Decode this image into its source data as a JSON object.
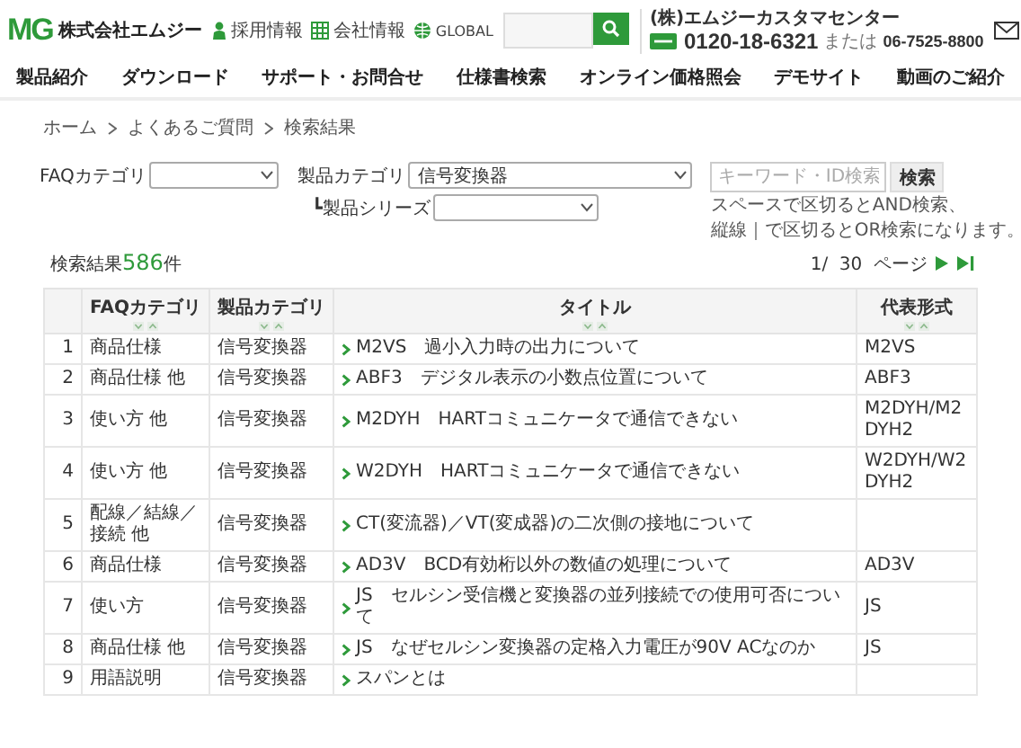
{
  "header": {
    "logo_mark": "MG",
    "company": "株式会社エムジー",
    "links": [
      {
        "kind": "person",
        "label": "採用情報"
      },
      {
        "kind": "building",
        "label": "会社情報"
      },
      {
        "kind": "globe",
        "label": "GLOBAL"
      }
    ],
    "support": {
      "label": "(株)エムジーカスタマセンター",
      "free_dial": "0120-18-6321",
      "or": "または",
      "phone": "06-7525-8800"
    }
  },
  "nav": [
    "製品紹介",
    "ダウンロード",
    "サポート・お問合せ",
    "仕様書検索",
    "オンライン価格照会",
    "デモサイト",
    "動画のご紹介"
  ],
  "breadcrumb": [
    "ホーム",
    "よくあるご質問",
    "検索結果"
  ],
  "filters": {
    "faq_category": {
      "label": "FAQカテゴリ"
    },
    "product_category": {
      "label": "製品カテゴリ",
      "value": "信号変換器"
    },
    "product_series": {
      "label": "┗製品シリーズ"
    },
    "keyword": {
      "placeholder": "キーワード・ID検索",
      "button": "検索",
      "help": [
        "スペースで区切るとAND検索、",
        "縦線｜で区切るとOR検索になります。"
      ]
    }
  },
  "results": {
    "prefix": "検索結果",
    "count": "586",
    "suffix": "件",
    "pager": "1/  30  ページ"
  },
  "table": {
    "columns": [
      "FAQカテゴリ",
      "製品カテゴリ",
      "タイトル",
      "代表形式"
    ],
    "rows": [
      {
        "no": "1",
        "faq": "商品仕様",
        "product": "信号変換器",
        "title": "M2VS　過小入力時の出力について",
        "model": "M2VS"
      },
      {
        "no": "2",
        "faq": "商品仕様 他",
        "product": "信号変換器",
        "title": "ABF3　デジタル表示の小数点位置について",
        "model": "ABF3"
      },
      {
        "no": "3",
        "faq": "使い方 他",
        "product": "信号変換器",
        "title": "M2DYH　HARTコミュニケータで通信できない",
        "model": "M2DYH/M2DYH2"
      },
      {
        "no": "4",
        "faq": "使い方 他",
        "product": "信号変換器",
        "title": "W2DYH　HARTコミュニケータで通信できない",
        "model": "W2DYH/W2DYH2"
      },
      {
        "no": "5",
        "faq": "配線／結線／接続 他",
        "product": "信号変換器",
        "title": "CT(変流器)／VT(変成器)の二次側の接地について"
      },
      {
        "no": "6",
        "faq": "商品仕様",
        "product": "信号変換器",
        "title": "AD3V　BCD有効桁以外の数値の処理について",
        "model": "AD3V"
      },
      {
        "no": "7",
        "faq": "使い方",
        "product": "信号変換器",
        "title": "JS　セルシン受信機と変換器の並列接続での使用可否について",
        "model": "JS"
      },
      {
        "no": "8",
        "faq": "商品仕様 他",
        "product": "信号変換器",
        "title": "JS　なぜセルシン変換器の定格入力電圧が90V ACなのか",
        "model": "JS"
      },
      {
        "no": "9",
        "faq": "用語説明",
        "product": "信号変換器",
        "title": "スパンとは"
      }
    ]
  }
}
